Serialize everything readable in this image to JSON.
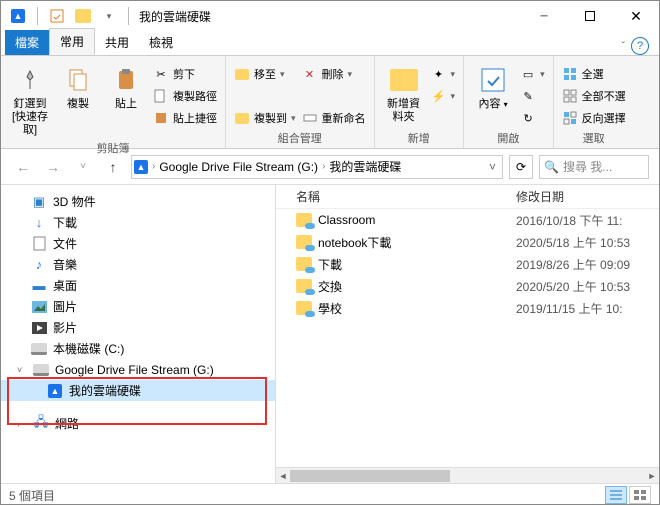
{
  "window": {
    "title": "我的雲端硬碟"
  },
  "tabs": {
    "file": "檔案",
    "home": "常用",
    "share": "共用",
    "view": "檢視"
  },
  "ribbon": {
    "clipboard": {
      "label": "剪貼簿",
      "pin": "釘選到 [快速存取]",
      "copy": "複製",
      "paste": "貼上",
      "cut": "剪下",
      "copypath": "複製路徑",
      "pasteshortcut": "貼上捷徑"
    },
    "organize": {
      "label": "組合管理",
      "moveto": "移至",
      "copyto": "複製到",
      "delete": "刪除",
      "rename": "重新命名"
    },
    "new": {
      "label": "新增",
      "newfolder": "新增資料夾"
    },
    "open": {
      "label": "開啟",
      "properties": "內容"
    },
    "select": {
      "label": "選取",
      "all": "全選",
      "none": "全部不選",
      "invert": "反向選擇"
    }
  },
  "breadcrumb": {
    "drive": "Google Drive File Stream (G:)",
    "folder": "我的雲端硬碟"
  },
  "search": {
    "placeholder": "搜尋 我..."
  },
  "nav": {
    "items": [
      "3D 物件",
      "下載",
      "文件",
      "音樂",
      "桌面",
      "圖片",
      "影片",
      "本機磁碟 (C:)",
      "Google Drive File Stream (G:)",
      "我的雲端硬碟",
      "網路"
    ]
  },
  "columns": {
    "name": "名稱",
    "modified": "修改日期"
  },
  "files": [
    {
      "name": "Classroom",
      "date": "2016/10/18 下午 11:"
    },
    {
      "name": "notebook下載",
      "date": "2020/5/18 上午 10:53"
    },
    {
      "name": "下載",
      "date": "2019/8/26 上午 09:09"
    },
    {
      "name": "交換",
      "date": "2020/5/20 上午 10:53"
    },
    {
      "name": "學校",
      "date": "2019/11/15 上午 10:"
    }
  ],
  "status": {
    "count": "5 個項目"
  }
}
